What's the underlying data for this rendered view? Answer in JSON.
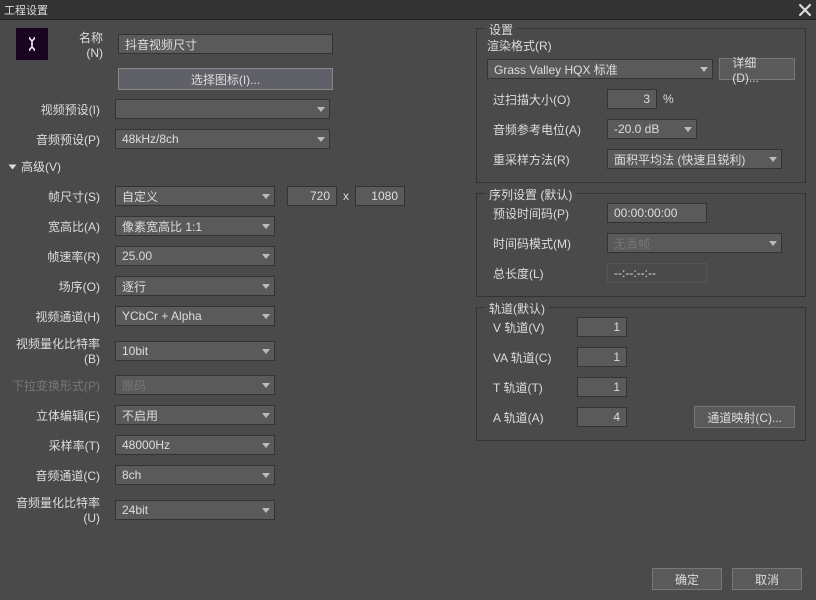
{
  "title": "工程设置",
  "left": {
    "name_label": "名称(N)",
    "name_value": "抖音视频尺寸",
    "select_icon_btn": "选择图标(I)...",
    "video_preset_label": "视频预设(I)",
    "video_preset_value": "",
    "audio_preset_label": "音频预设(P)",
    "audio_preset_value": "48kHz/8ch",
    "advanced_label": "高级(V)",
    "frame_size_label": "帧尺寸(S)",
    "frame_size_value": "自定义",
    "frame_w": "720",
    "frame_h": "1080",
    "aspect_label": "宽高比(A)",
    "aspect_value": "像素宽高比 1:1",
    "fps_label": "帧速率(R)",
    "fps_value": "25.00",
    "field_label": "场序(O)",
    "field_value": "逐行",
    "vchan_label": "视频通道(H)",
    "vchan_value": "YCbCr + Alpha",
    "vquant_label": "视频量化比特率(B)",
    "vquant_value": "10bit",
    "pulldown_label": "下拉变换形式(P)",
    "pulldown_value": "原码",
    "stereo_label": "立体编辑(E)",
    "stereo_value": "不启用",
    "srate_label": "采样率(T)",
    "srate_value": "48000Hz",
    "achan_label": "音频通道(C)",
    "achan_value": "8ch",
    "aquant_label": "音频量化比特率(U)",
    "aquant_value": "24bit"
  },
  "settings": {
    "title": "设置",
    "render_format_label": "渲染格式(R)",
    "render_format_value": "Grass Valley HQX 标准",
    "detail_btn": "详细(D)...",
    "overscan_label": "过扫描大小(O)",
    "overscan_value": "3",
    "overscan_unit": "%",
    "aref_label": "音频参考电位(A)",
    "aref_value": "-20.0 dB",
    "resample_label": "重采样方法(R)",
    "resample_value": "面积平均法 (快速且锐利)"
  },
  "sequence": {
    "title": "序列设置 (默认)",
    "preset_tc_label": "预设时间码(P)",
    "preset_tc_value": "00:00:00:00",
    "tcmode_label": "时间码模式(M)",
    "tcmode_value": "无丢帧",
    "totallen_label": "总长度(L)",
    "totallen_value": "--:--:--:--"
  },
  "tracks": {
    "title": "轨道(默认)",
    "v_label": "V 轨道(V)",
    "v_value": "1",
    "va_label": "VA 轨道(C)",
    "va_value": "1",
    "t_label": "T 轨道(T)",
    "t_value": "1",
    "a_label": "A 轨道(A)",
    "a_value": "4",
    "map_btn": "通道映射(C)..."
  },
  "footer": {
    "ok": "确定",
    "cancel": "取消"
  }
}
